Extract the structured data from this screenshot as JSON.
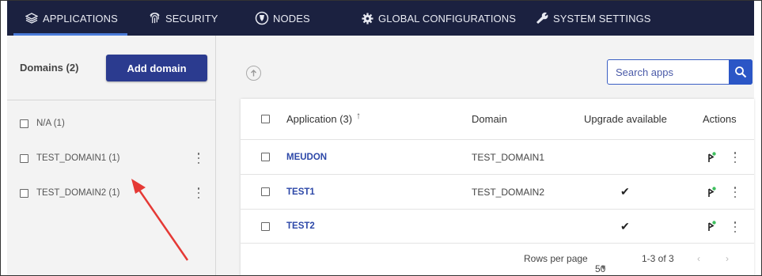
{
  "nav": {
    "tabs": [
      {
        "label": "APPLICATIONS",
        "icon": "layers-icon"
      },
      {
        "label": "SECURITY",
        "icon": "fingerprint-icon"
      },
      {
        "label": "NODES",
        "icon": "node-icon"
      },
      {
        "label": "GLOBAL CONFIGURATIONS",
        "icon": "gear-icon"
      },
      {
        "label": "SYSTEM SETTINGS",
        "icon": "wrench-icon"
      }
    ],
    "active_tab": "APPLICATIONS"
  },
  "domains_panel": {
    "title": "Domains (2)",
    "add_button": "Add domain",
    "items": [
      {
        "label": "N/A (1)",
        "has_menu": false
      },
      {
        "label": "TEST_DOMAIN1 (1)",
        "has_menu": true
      },
      {
        "label": "TEST_DOMAIN2 (1)",
        "has_menu": true
      }
    ]
  },
  "search": {
    "placeholder": "Search apps"
  },
  "table": {
    "headers": {
      "application": "Application (3)",
      "sort_indicator": "↑",
      "domain": "Domain",
      "upgrade": "Upgrade available",
      "actions": "Actions"
    },
    "rows": [
      {
        "application": "MEUDON",
        "domain": "TEST_DOMAIN1",
        "upgrade": ""
      },
      {
        "application": "TEST1",
        "domain": "TEST_DOMAIN2",
        "upgrade": "✔"
      },
      {
        "application": "TEST2",
        "domain": "",
        "upgrade": "✔"
      }
    ],
    "footer": {
      "rows_per_page_label": "Rows per page",
      "rows_per_page_value": "50",
      "range": "1-3 of 3"
    }
  },
  "colors": {
    "nav_bg": "#1b2140",
    "nav_active_underline": "#4a7bd8",
    "primary_button": "#2b3b8f",
    "link": "#2d48a8",
    "status_dot": "#3fbf5f",
    "annotation_arrow": "#e53935"
  }
}
